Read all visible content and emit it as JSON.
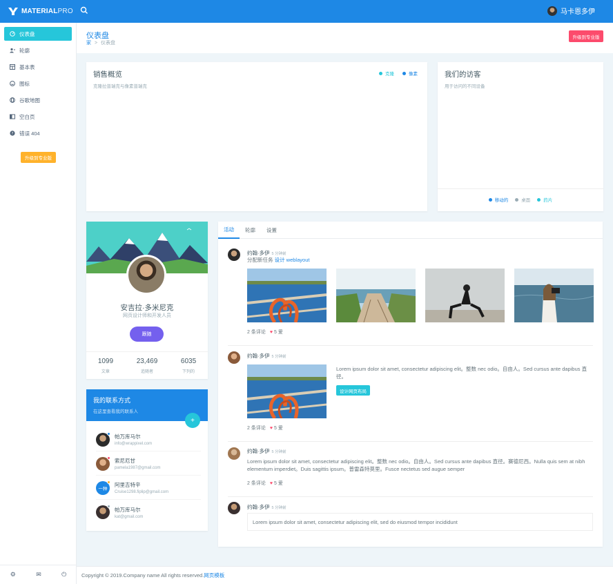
{
  "brand": {
    "name_bold": "MATERIAL",
    "name_thin": "PRO"
  },
  "header": {
    "user_name": "马卡恩多伊"
  },
  "sidebar": {
    "items": [
      {
        "label": "仪表盘",
        "icon": "dashboard-icon"
      },
      {
        "label": "轮廓",
        "icon": "user-icon"
      },
      {
        "label": "基本表",
        "icon": "table-icon"
      },
      {
        "label": "图标",
        "icon": "smile-icon"
      },
      {
        "label": "谷歌地图",
        "icon": "globe-icon"
      },
      {
        "label": "空白页",
        "icon": "book-icon"
      },
      {
        "label": "错误 404",
        "icon": "help-icon"
      }
    ],
    "upgrade_label": "升级到专业版"
  },
  "page": {
    "title": "仪表盘",
    "breadcrumb_home": "家",
    "breadcrumb_sep": ">",
    "breadcrumb_current": "仪表盘",
    "pro_button": "升级到专业版"
  },
  "sales": {
    "title": "销售概览",
    "subtitle": "克隆拉普瑞克与像素普瑞克",
    "legend": [
      {
        "label": "克隆",
        "color": "#26c6da"
      },
      {
        "label": "像素",
        "color": "#1e88e5"
      }
    ]
  },
  "visitors": {
    "title": "我们的访客",
    "subtitle": "用于访问的不同设备",
    "legend": [
      {
        "label": "移动的",
        "color": "#1e88e5"
      },
      {
        "label": "桌面",
        "color": "#99abb4"
      },
      {
        "label": "药片",
        "color": "#26c6da"
      }
    ]
  },
  "profile": {
    "name": "安吉拉·多米尼克",
    "role": "网页设计师和开发人员",
    "follow_label": "跟随",
    "stats": [
      {
        "value": "1099",
        "label": "文章"
      },
      {
        "value": "23,469",
        "label": "追随者"
      },
      {
        "value": "6035",
        "label": "下列的"
      }
    ]
  },
  "contacts": {
    "title": "我的联系方式",
    "subtitle": "在这里查看我的联系人",
    "add_label": "+",
    "items": [
      {
        "name": "帕万库马尔",
        "email": "info@wrappixel.com",
        "status_color": "#1e88e5"
      },
      {
        "name": "索尼厄甘",
        "email": "pamela1987@gmail.com",
        "status_color": "#fc4b6c"
      },
      {
        "name": "阿里吉特辛",
        "email": "Cruise1298.fiplip@gmail.com",
        "status_color": "#ffb22b",
        "initials": "一种"
      },
      {
        "name": "帕万库马尔",
        "email": "kat@gmail.com",
        "status_color": "#99abb4"
      }
    ]
  },
  "feed": {
    "tabs": [
      "活动",
      "轮廓",
      "设置"
    ],
    "items": [
      {
        "name": "约翰·多伊",
        "time": "5 分钟前",
        "text_prefix": "分配新任务",
        "text_link": "设计 weblayout",
        "comments": "2 条评论",
        "likes": "5 爱"
      },
      {
        "name": "约翰·多伊",
        "time": "5 分钟前",
        "text": "Lorem ipsum dolor sit amet, consectetur adipiscing elit。整数 nec odio。自由人。Sed cursus ante dapibus 直径。",
        "button": "设计网页布局",
        "comments": "2 条评论",
        "likes": "5 爱"
      },
      {
        "name": "约翰·多伊",
        "time": "5 分钟前",
        "text": "Lorem ipsum dolor sit amet, consectetur adipiscing elit。整数 nec odio。自由人。Sed cursus ante dapibus 直径。赛德尼西。Nulla quis sem at nibh elementum imperdiet。Duis sagittis ipsum。普雷森特莫里。Fusce nectetus sed augue semper",
        "comments": "2 条评论",
        "likes": "5 爱"
      },
      {
        "name": "约翰·多伊",
        "time": "5 分钟前",
        "quote": "Lorem ipsum dolor sit amet, consectetur adipiscing elit, sed do eiusmod tempor incididunt"
      }
    ]
  },
  "footer": {
    "text": "Copyright © 2019.Company name All rights reserved.",
    "link": "网页模板"
  }
}
